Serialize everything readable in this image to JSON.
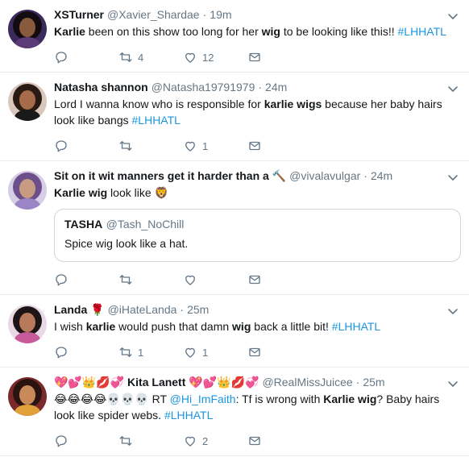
{
  "tweets": [
    {
      "name": "XSTurner",
      "handle": "@Xavier_Shardae",
      "time": "19m",
      "text_parts": [
        {
          "t": "Karlie",
          "b": true
        },
        {
          "t": " been on this show too long for her ",
          "b": false
        },
        {
          "t": "wig",
          "b": true
        },
        {
          "t": " to be looking like this!! ",
          "b": false
        },
        {
          "t": "#LHHATL",
          "tag": true
        }
      ],
      "retweets": "4",
      "likes": "12",
      "avatar_colors": {
        "bg": "#3b2a5c",
        "hair": "#120c10",
        "face": "#8a5a3e",
        "body": "#5b3a78"
      }
    },
    {
      "name": "Natasha shannon",
      "handle": "@Natasha19791979",
      "time": "24m",
      "text_parts": [
        {
          "t": "Lord I wanna know who is responsible for ",
          "b": false
        },
        {
          "t": "karlie wigs",
          "b": true
        },
        {
          "t": " because her baby hairs look like bangs ",
          "b": false
        },
        {
          "t": "#LHHATL",
          "tag": true
        }
      ],
      "retweets": "",
      "likes": "1",
      "avatar_colors": {
        "bg": "#d9c7bd",
        "hair": "#2a1a14",
        "face": "#a56b4a",
        "body": "#1a1a1a"
      }
    },
    {
      "name": "Sit on it wit manners get it harder than a 🔨",
      "handle": "@vivalavulgar",
      "time": "24m",
      "text_parts": [
        {
          "t": "Karlie",
          "b": true
        },
        {
          "t": " ",
          "b": false
        },
        {
          "t": "wig",
          "b": true
        },
        {
          "t": " look like 🦁",
          "b": false
        }
      ],
      "quote": {
        "name": "TASHA",
        "handle": "@Tash_NoChill",
        "text": "Spice wig look like a hat."
      },
      "retweets": "",
      "likes": "",
      "avatar_colors": {
        "bg": "#d6cde6",
        "hair": "#6c4f8a",
        "face": "#c69b82",
        "body": "#9a86c4"
      }
    },
    {
      "name": "Landa 🌹",
      "handle": "@iHateLanda",
      "time": "25m",
      "text_parts": [
        {
          "t": "I wish ",
          "b": false
        },
        {
          "t": "karlie",
          "b": true
        },
        {
          "t": " would push that damn ",
          "b": false
        },
        {
          "t": "wig",
          "b": true
        },
        {
          "t": " back a little bit! ",
          "b": false
        },
        {
          "t": "#LHHATL",
          "tag": true
        }
      ],
      "retweets": "1",
      "likes": "1",
      "avatar_colors": {
        "bg": "#e9d9e6",
        "hair": "#1d1416",
        "face": "#b97a5c",
        "body": "#c95a9a"
      }
    },
    {
      "name": "💖💕👑💋💞 Kita Lanett 💖💕👑💋💞",
      "handle": "@RealMissJuicee",
      "time": "25m",
      "text_parts": [
        {
          "t": "😂😂😂😂💀💀💀 RT ",
          "b": false
        },
        {
          "t": "@Hi_ImFaith",
          "tag": true
        },
        {
          "t": ": Tf is wrong with ",
          "b": false
        },
        {
          "t": "Karlie wig",
          "b": true
        },
        {
          "t": "? Baby hairs look like spider webs. ",
          "b": false
        },
        {
          "t": "#LHHATL",
          "tag": true
        }
      ],
      "retweets": "",
      "likes": "2",
      "avatar_colors": {
        "bg": "#7a2a2a",
        "hair": "#2a1410",
        "face": "#c98a5a",
        "body": "#e0a03a"
      }
    }
  ],
  "icons": [
    "reply-icon",
    "retweet-icon",
    "like-icon",
    "dm-icon",
    "caret-down-icon"
  ],
  "colors": {
    "text": "#14171a",
    "secondary": "#657786",
    "link": "#1b95e0",
    "border": "#e6ecf0"
  }
}
